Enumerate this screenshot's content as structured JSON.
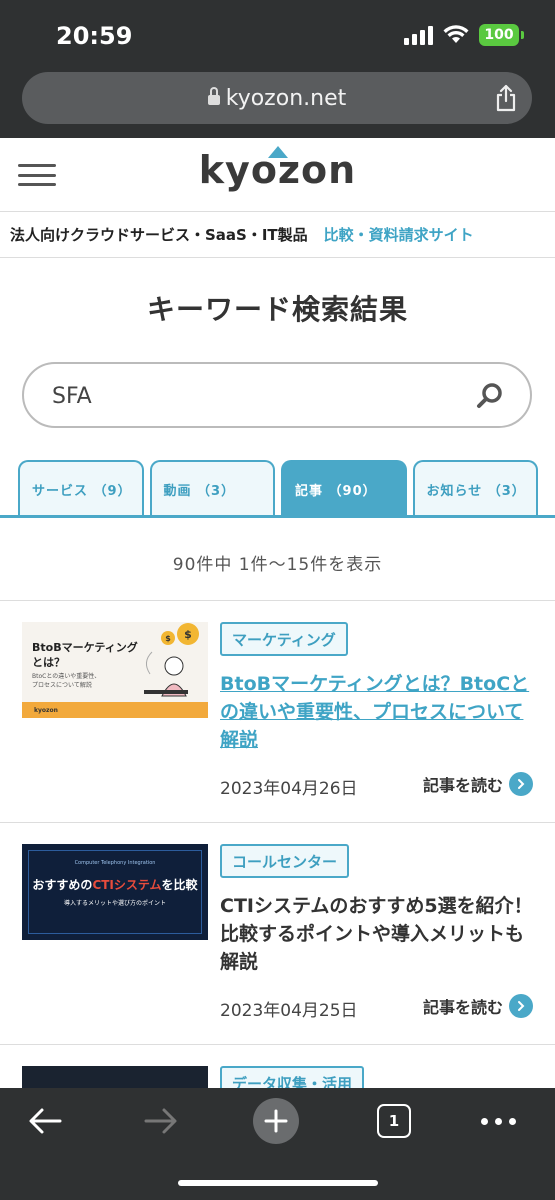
{
  "status_bar": {
    "time": "20:59",
    "battery": "100"
  },
  "browser": {
    "url": "kyozon.net"
  },
  "site": {
    "logo": "kyozon",
    "tagline_main": "法人向けクラウドサービス・SaaS・IT製品",
    "tagline_accent": "比較・資料請求サイト",
    "accent_color": "#4aa8c8"
  },
  "page": {
    "title": "キーワード検索結果",
    "search_value": "SFA",
    "result_count": "90件中 1件〜15件を表示"
  },
  "tabs": [
    {
      "label": "サービス （9）",
      "active": false
    },
    {
      "label": "動画 （3）",
      "active": false
    },
    {
      "label": "記事 （90）",
      "active": true
    },
    {
      "label": "お知らせ （3）",
      "active": false
    }
  ],
  "articles": [
    {
      "category": "マーケティング",
      "title": "BtoBマーケティングとは？BtoCとの違いや重要性、プロセスについて解説",
      "date": "2023年04月26日",
      "read_more": "記事を読む",
      "thumb_title": "BtoBマーケティング\nとは？",
      "thumb_sub": "BtoCとの違いや重要性、\nプロセスについて解説",
      "thumb_logo": "kyozon"
    },
    {
      "category": "コールセンター",
      "title": "CTIシステムのおすすめ5選を紹介！比較するポイントや導入メリットも解説",
      "date": "2023年04月25日",
      "read_more": "記事を読む",
      "thumb_sub": "Computer Telephony Integration",
      "thumb_pre": "おすすめの",
      "thumb_hl": "CTIシステム",
      "thumb_post": "を比較",
      "thumb_small": "導入するメリットや選び方のポイント"
    },
    {
      "category": "データ収集・活用"
    }
  ],
  "toolbar": {
    "tab_count": "1"
  }
}
